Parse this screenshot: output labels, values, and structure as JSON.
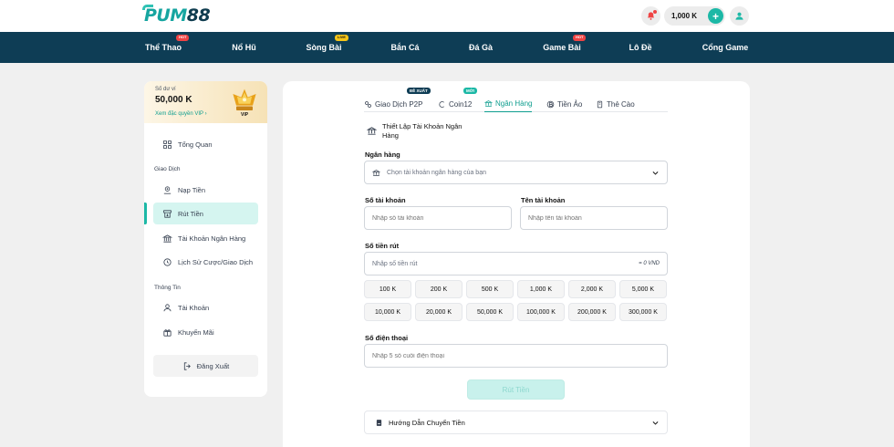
{
  "header": {
    "logo_text_brand": "PUM",
    "logo_text_number": "88",
    "balance": "1,000 K",
    "plus": "+"
  },
  "nav": {
    "items": [
      {
        "label": "Thể Thao",
        "badge": "HOT",
        "badge_type": "hot"
      },
      {
        "label": "Nổ Hũ",
        "badge": "",
        "badge_type": ""
      },
      {
        "label": "Sòng Bài",
        "badge": "LIVE",
        "badge_type": "live"
      },
      {
        "label": "Bắn Cá",
        "badge": "",
        "badge_type": ""
      },
      {
        "label": "Đá Gà",
        "badge": "",
        "badge_type": ""
      },
      {
        "label": "Game Bài",
        "badge": "HOT",
        "badge_type": "hot"
      },
      {
        "label": "Lô Đề",
        "badge": "",
        "badge_type": ""
      },
      {
        "label": "Cổng Game",
        "badge": "",
        "badge_type": ""
      }
    ]
  },
  "sidebar": {
    "wallet_label": "Số dư ví",
    "wallet_amount": "50,000 K",
    "wallet_link": "Xem đặc quyền VIP",
    "vip_label": "VIP",
    "overview": "Tổng Quan",
    "section_transactions": "Giao Dịch",
    "deposit": "Nạp Tiền",
    "withdraw": "Rút Tiền",
    "bank_account": "Tài Khoản Ngân Hàng",
    "history": "Lịch Sử Cược/Giao Dịch",
    "section_info": "Thông Tin",
    "account": "Tài Khoản",
    "promotions": "Khuyến Mãi",
    "logout": "Đăng Xuất"
  },
  "tabs": [
    {
      "label": "Giao Dịch P2P",
      "badge": "ĐỀ XUẤT"
    },
    {
      "label": "Coin12",
      "badge": "MỚI"
    },
    {
      "label": "Ngân Hàng",
      "badge": ""
    },
    {
      "label": "Tiền Ảo",
      "badge": ""
    },
    {
      "label": "Thẻ Cào",
      "badge": ""
    }
  ],
  "form": {
    "section_title": "Thiết Lập Tài Khoản Ngân Hàng",
    "bank_label": "Ngân hàng",
    "bank_placeholder": "Chọn tài khoản ngân hàng của bạn",
    "account_number_label": "Số tài khoản",
    "account_number_placeholder": "Nhập số tài khoản",
    "account_name_label": "Tên tài khoản",
    "account_name_placeholder": "Nhập tên tài khoản",
    "amount_label": "Số tiền rút",
    "amount_placeholder": "Nhập số tiền rút",
    "amount_suffix": "= 0 VND",
    "quick_amounts": [
      "100 K",
      "200 K",
      "500 K",
      "1,000 K",
      "2,000 K",
      "5,000 K",
      "10,000 K",
      "20,000 K",
      "50,000 K",
      "100,000 K",
      "200,000 K",
      "300,000 K"
    ],
    "phone_label": "Số điện thoại",
    "phone_placeholder": "Nhập 5 số cuối điện thoại",
    "submit": "Rút Tiền",
    "guide": "Hướng Dẫn Chuyển Tiền"
  },
  "colors": {
    "brand_teal": "#1cb8a6",
    "nav_navy": "#0e3d55",
    "hot_badge": "#ef4444",
    "live_badge": "#f5c518"
  }
}
